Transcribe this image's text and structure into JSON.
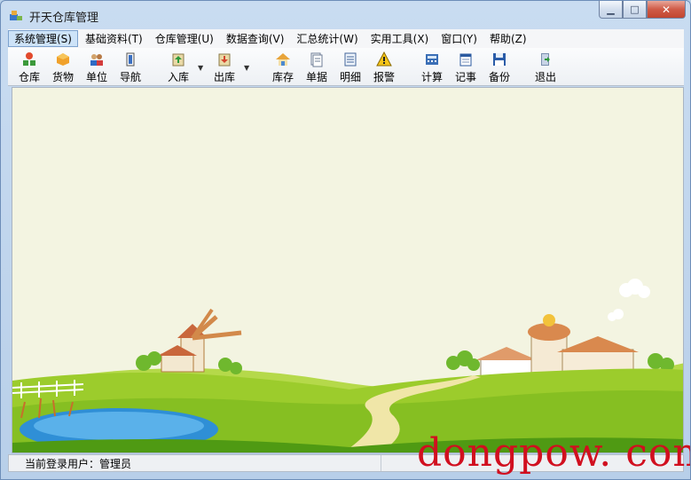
{
  "window": {
    "title": "开天仓库管理",
    "buttons": {
      "minimize": "▁",
      "maximize": "□",
      "close": "✕"
    }
  },
  "menubar": {
    "items": [
      {
        "label": "系统管理(S)"
      },
      {
        "label": "基础资料(T)"
      },
      {
        "label": "仓库管理(U)"
      },
      {
        "label": "数据查询(V)"
      },
      {
        "label": "汇总统计(W)"
      },
      {
        "label": "实用工具(X)"
      },
      {
        "label": "窗口(Y)"
      },
      {
        "label": "帮助(Z)"
      }
    ]
  },
  "toolbar": {
    "items": [
      {
        "label": "仓库",
        "icon": "warehouse-icon"
      },
      {
        "label": "货物",
        "icon": "goods-box-icon"
      },
      {
        "label": "单位",
        "icon": "people-icon"
      },
      {
        "label": "导航",
        "icon": "navigation-icon"
      },
      {
        "label": "入库",
        "icon": "stock-in-icon"
      },
      {
        "label": "出库",
        "icon": "stock-out-icon"
      },
      {
        "label": "库存",
        "icon": "inventory-house-icon"
      },
      {
        "label": "单据",
        "icon": "documents-icon"
      },
      {
        "label": "明细",
        "icon": "detail-list-icon"
      },
      {
        "label": "报警",
        "icon": "warning-icon"
      },
      {
        "label": "计算",
        "icon": "calculator-icon"
      },
      {
        "label": "记事",
        "icon": "notepad-icon"
      },
      {
        "label": "备份",
        "icon": "floppy-disk-icon"
      },
      {
        "label": "退出",
        "icon": "exit-door-icon"
      }
    ],
    "dropdown_arrow": "▼"
  },
  "statusbar": {
    "current_user": "当前登录用户：管理员",
    "panel2": ""
  },
  "watermark": "dongpow. com",
  "colors": {
    "sky": "#f3f4e1",
    "grass_light": "#9ccc2c",
    "grass_dark": "#4f9a13",
    "pond": "#2f8fd6",
    "path": "#f0e6a8",
    "watermark": "#d10f1f"
  }
}
